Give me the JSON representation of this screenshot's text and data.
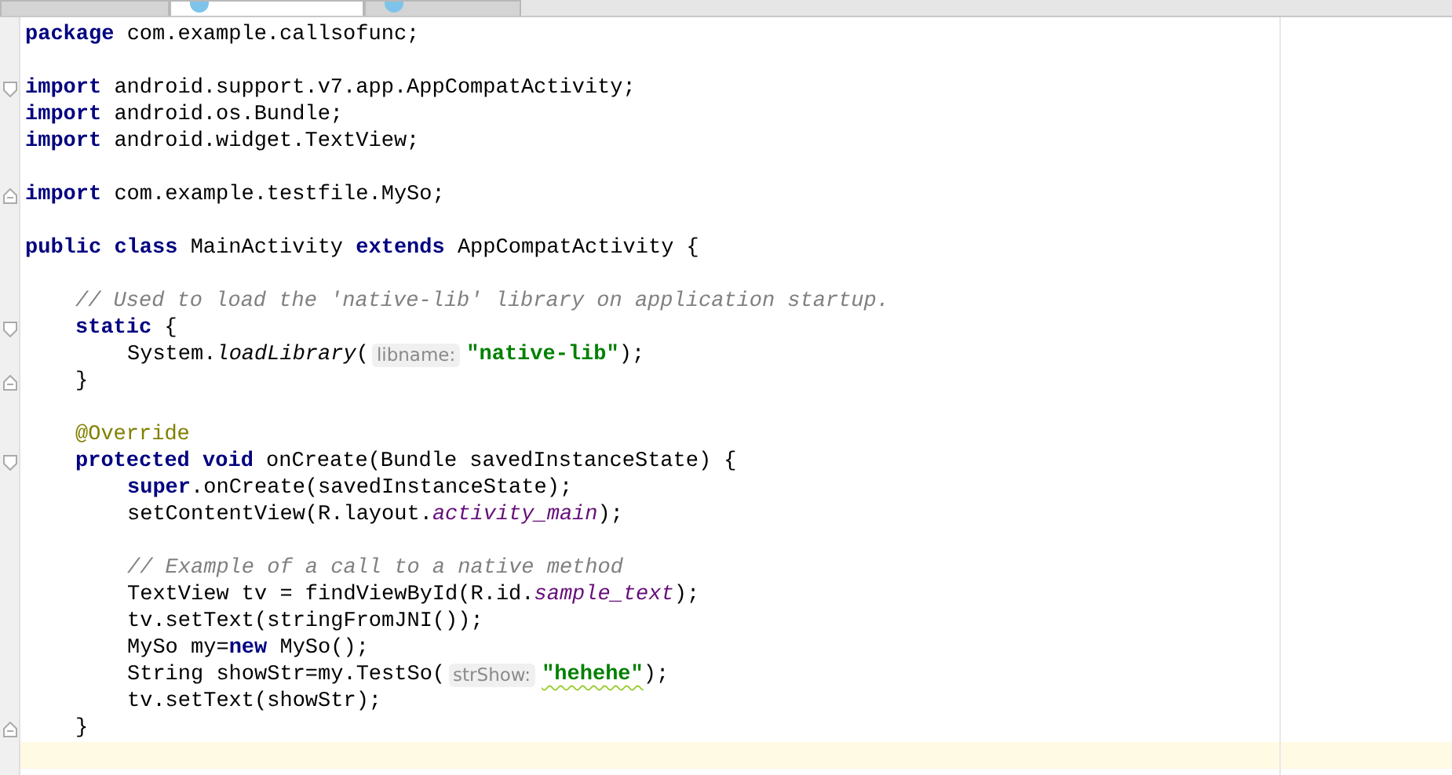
{
  "tabs": [
    {
      "selected": false
    },
    {
      "selected": true
    },
    {
      "selected": false
    }
  ],
  "lines": [
    {
      "kind": "top",
      "tokens": [
        {
          "kind": "kw",
          "text": "package"
        },
        {
          "kind": "plain",
          "text": " com.example.callsofunc;"
        }
      ]
    },
    {
      "kind": "blank"
    },
    {
      "kind": "top",
      "fold_start": true,
      "tokens": [
        {
          "kind": "kw",
          "text": "import"
        },
        {
          "kind": "plain",
          "text": " android.support.v7.app.AppCompatActivity;"
        }
      ]
    },
    {
      "kind": "top",
      "tokens": [
        {
          "kind": "kw",
          "text": "import"
        },
        {
          "kind": "plain",
          "text": " android.os.Bundle;"
        }
      ]
    },
    {
      "kind": "top",
      "tokens": [
        {
          "kind": "kw",
          "text": "import"
        },
        {
          "kind": "plain",
          "text": " android.widget.TextView;"
        }
      ]
    },
    {
      "kind": "blank"
    },
    {
      "kind": "top",
      "fold_end": true,
      "tokens": [
        {
          "kind": "kw",
          "text": "import"
        },
        {
          "kind": "plain",
          "text": " com.example.testfile.MySo;"
        }
      ]
    },
    {
      "kind": "blank"
    },
    {
      "kind": "top",
      "tokens": [
        {
          "kind": "kw",
          "text": "public class"
        },
        {
          "kind": "plain",
          "text": " MainActivity "
        },
        {
          "kind": "kw",
          "text": "extends"
        },
        {
          "kind": "plain",
          "text": " AppCompatActivity {"
        }
      ]
    },
    {
      "kind": "blank"
    },
    {
      "kind": "member",
      "tokens": [
        {
          "kind": "comment",
          "text": "// Used to load the 'native-lib' library on application startup."
        }
      ]
    },
    {
      "kind": "member",
      "fold_start": true,
      "tokens": [
        {
          "kind": "kw",
          "text": "static"
        },
        {
          "kind": "plain",
          "text": " {"
        }
      ]
    },
    {
      "kind": "body",
      "tokens": [
        {
          "kind": "plain",
          "text": "System."
        },
        {
          "kind": "italic",
          "text": "loadLibrary"
        },
        {
          "kind": "plain",
          "text": "("
        },
        {
          "kind": "hint",
          "text": "libname:"
        },
        {
          "kind": "str",
          "text": "\"native-lib\""
        },
        {
          "kind": "plain",
          "text": ");"
        }
      ]
    },
    {
      "kind": "member",
      "fold_end": true,
      "tokens": [
        {
          "kind": "plain",
          "text": "}"
        }
      ]
    },
    {
      "kind": "blank"
    },
    {
      "kind": "member",
      "tokens": [
        {
          "kind": "ann",
          "text": "@Override"
        }
      ]
    },
    {
      "kind": "member",
      "fold_start": true,
      "tokens": [
        {
          "kind": "kw",
          "text": "protected void"
        },
        {
          "kind": "plain",
          "text": " onCreate(Bundle savedInstanceState) {"
        }
      ]
    },
    {
      "kind": "body",
      "tokens": [
        {
          "kind": "kw",
          "text": "super"
        },
        {
          "kind": "plain",
          "text": ".onCreate(savedInstanceState);"
        }
      ]
    },
    {
      "kind": "body",
      "tokens": [
        {
          "kind": "plain",
          "text": "setContentView(R.layout."
        },
        {
          "kind": "field",
          "text": "activity_main"
        },
        {
          "kind": "plain",
          "text": ");"
        }
      ]
    },
    {
      "kind": "blank"
    },
    {
      "kind": "body",
      "tokens": [
        {
          "kind": "comment",
          "text": "// Example of a call to a native method"
        }
      ]
    },
    {
      "kind": "body",
      "tokens": [
        {
          "kind": "plain",
          "text": "TextView tv = findViewById(R.id."
        },
        {
          "kind": "field",
          "text": "sample_text"
        },
        {
          "kind": "plain",
          "text": ");"
        }
      ]
    },
    {
      "kind": "body",
      "tokens": [
        {
          "kind": "plain",
          "text": "tv.setText(stringFromJNI());"
        }
      ]
    },
    {
      "kind": "body",
      "tokens": [
        {
          "kind": "plain",
          "text": "MySo my="
        },
        {
          "kind": "kw",
          "text": "new"
        },
        {
          "kind": "plain",
          "text": " MySo();"
        }
      ]
    },
    {
      "kind": "body",
      "tokens": [
        {
          "kind": "plain",
          "text": "String showStr=my.TestSo("
        },
        {
          "kind": "hint",
          "text": "strShow:"
        },
        {
          "kind": "str",
          "text": "\"hehehe\"",
          "squiggle": true
        },
        {
          "kind": "plain",
          "text": ");"
        }
      ]
    },
    {
      "kind": "body",
      "tokens": [
        {
          "kind": "plain",
          "text": "tv.setText(showStr);"
        }
      ]
    },
    {
      "kind": "member",
      "fold_end": true,
      "tokens": [
        {
          "kind": "plain",
          "text": "}"
        }
      ]
    },
    {
      "kind": "blank",
      "current": true
    }
  ]
}
